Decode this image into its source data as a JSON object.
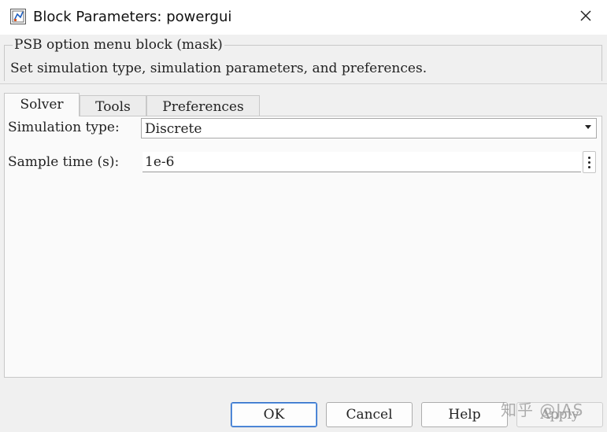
{
  "window": {
    "title": "Block Parameters: powergui",
    "icon": "simulink-block-icon",
    "close_icon": "close-icon"
  },
  "description": {
    "group_title": "PSB option menu block (mask)",
    "text": "Set simulation type, simulation parameters, and preferences."
  },
  "tabs": [
    {
      "label": "Solver",
      "active": true
    },
    {
      "label": "Tools",
      "active": false
    },
    {
      "label": "Preferences",
      "active": false
    }
  ],
  "solver": {
    "simulation_type_label": "Simulation type:",
    "simulation_type_value": "Discrete",
    "sample_time_label": "Sample time (s):",
    "sample_time_value": "1e-6",
    "sample_time_menu_icon": "more-options-icon"
  },
  "buttons": {
    "ok": "OK",
    "cancel": "Cancel",
    "help": "Help",
    "apply": "Apply"
  },
  "watermark": "知乎 @JAS",
  "colors": {
    "ok_border": "#2f6cc6",
    "dialog_bg": "#f0f0f0",
    "panel_bg": "#fafafa"
  }
}
